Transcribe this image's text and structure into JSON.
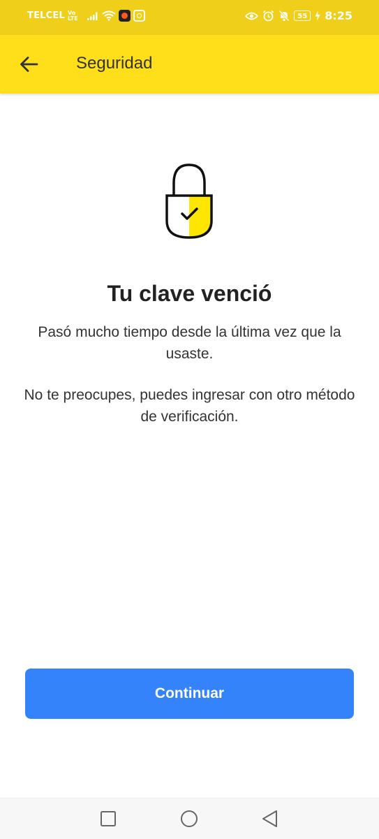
{
  "status_bar": {
    "carrier": "TELCEL",
    "volte_top": "Vo",
    "volte_bottom": "LTE",
    "battery": "55",
    "time": "8:25",
    "icons": [
      "signal-icon",
      "wifi-icon",
      "app-notification-icon",
      "eye-icon",
      "alarm-icon",
      "bell-off-icon",
      "battery-icon",
      "charging-icon"
    ]
  },
  "app_bar": {
    "back_icon": "arrow-left-icon",
    "title": "Seguridad"
  },
  "content": {
    "illustration": "lock-check-icon",
    "heading": "Tu clave venció",
    "paragraph1": "Pasó mucho tiempo desde la última vez que la usaste.",
    "paragraph2": "No te preocupes, puedes ingresar con otro método de verificación."
  },
  "actions": {
    "continue_label": "Continuar"
  },
  "nav_bar": {
    "items": [
      "recents-square-icon",
      "home-circle-icon",
      "back-triangle-icon"
    ]
  },
  "colors": {
    "status_bar": "#efcf19",
    "app_bar": "#ffdf1a",
    "primary_button": "#3483fa",
    "lock_accent": "#ffe600"
  }
}
